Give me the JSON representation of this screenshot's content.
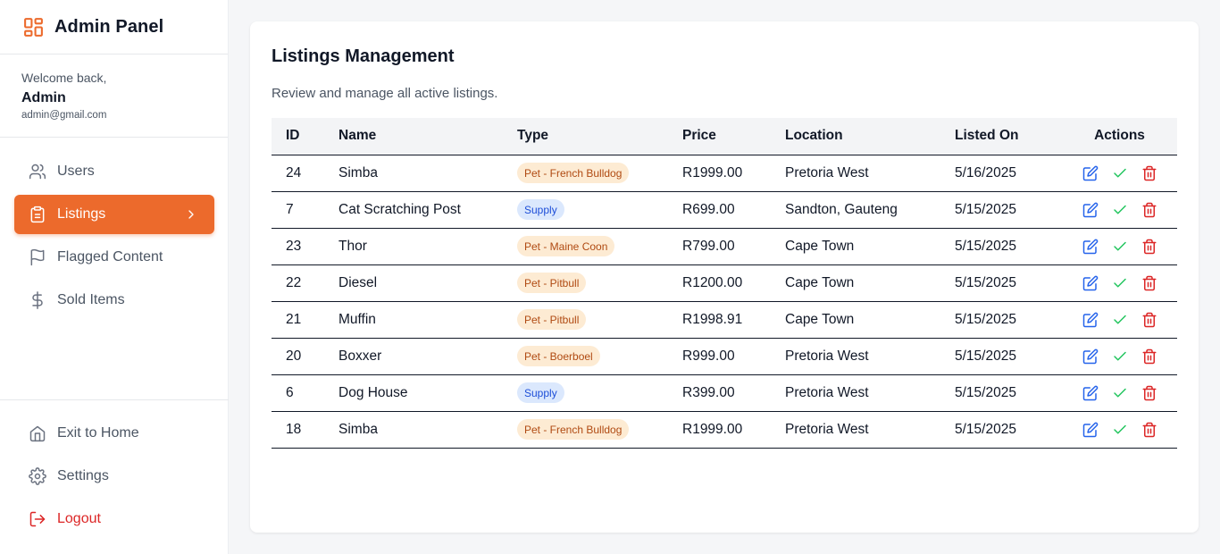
{
  "app": {
    "title": "Admin Panel"
  },
  "welcome": {
    "label": "Welcome back,",
    "name": "Admin",
    "email": "admin@gmail.com"
  },
  "nav": [
    {
      "label": "Users",
      "icon": "users-icon"
    },
    {
      "label": "Listings",
      "icon": "clipboard-icon",
      "active": true
    },
    {
      "label": "Flagged Content",
      "icon": "flag-icon"
    },
    {
      "label": "Sold Items",
      "icon": "dollar-icon"
    }
  ],
  "bottom_nav": [
    {
      "label": "Exit to Home",
      "icon": "home-icon"
    },
    {
      "label": "Settings",
      "icon": "gear-icon"
    },
    {
      "label": "Logout",
      "icon": "logout-icon"
    }
  ],
  "page": {
    "title": "Listings Management",
    "subtitle": "Review and manage all active listings."
  },
  "table": {
    "headers": [
      "ID",
      "Name",
      "Type",
      "Price",
      "Location",
      "Listed On",
      "Actions"
    ],
    "rows": [
      {
        "id": "24",
        "name": "Simba",
        "type": "Pet - French Bulldog",
        "price": "R1999.00",
        "location": "Pretoria West",
        "date": "5/16/2025"
      },
      {
        "id": "7",
        "name": "Cat Scratching Post",
        "type": "Supply",
        "price": "R699.00",
        "location": "Sandton, Gauteng",
        "date": "5/15/2025"
      },
      {
        "id": "23",
        "name": "Thor",
        "type": "Pet - Maine Coon",
        "price": "R799.00",
        "location": "Cape Town",
        "date": "5/15/2025"
      },
      {
        "id": "22",
        "name": "Diesel",
        "type": "Pet - Pitbull",
        "price": "R1200.00",
        "location": "Cape Town",
        "date": "5/15/2025"
      },
      {
        "id": "21",
        "name": "Muffin",
        "type": "Pet - Pitbull",
        "price": "R1998.91",
        "location": "Cape Town",
        "date": "5/15/2025"
      },
      {
        "id": "20",
        "name": "Boxxer",
        "type": "Pet - Boerboel",
        "price": "R999.00",
        "location": "Pretoria West",
        "date": "5/15/2025"
      },
      {
        "id": "6",
        "name": "Dog House",
        "type": "Supply",
        "price": "R399.00",
        "location": "Pretoria West",
        "date": "5/15/2025"
      },
      {
        "id": "18",
        "name": "Simba",
        "type": "Pet - French Bulldog",
        "price": "R1999.00",
        "location": "Pretoria West",
        "date": "5/15/2025"
      }
    ]
  },
  "colors": {
    "accent": "#ec6a2c",
    "pet_badge_bg": "#fdebd3",
    "pet_badge_text": "#b04a12",
    "supply_badge_bg": "#dbe8fd",
    "supply_badge_text": "#1d4ed8",
    "edit": "#2563eb",
    "approve": "#22c55e",
    "delete": "#dc2626",
    "logout": "#dc2626"
  }
}
